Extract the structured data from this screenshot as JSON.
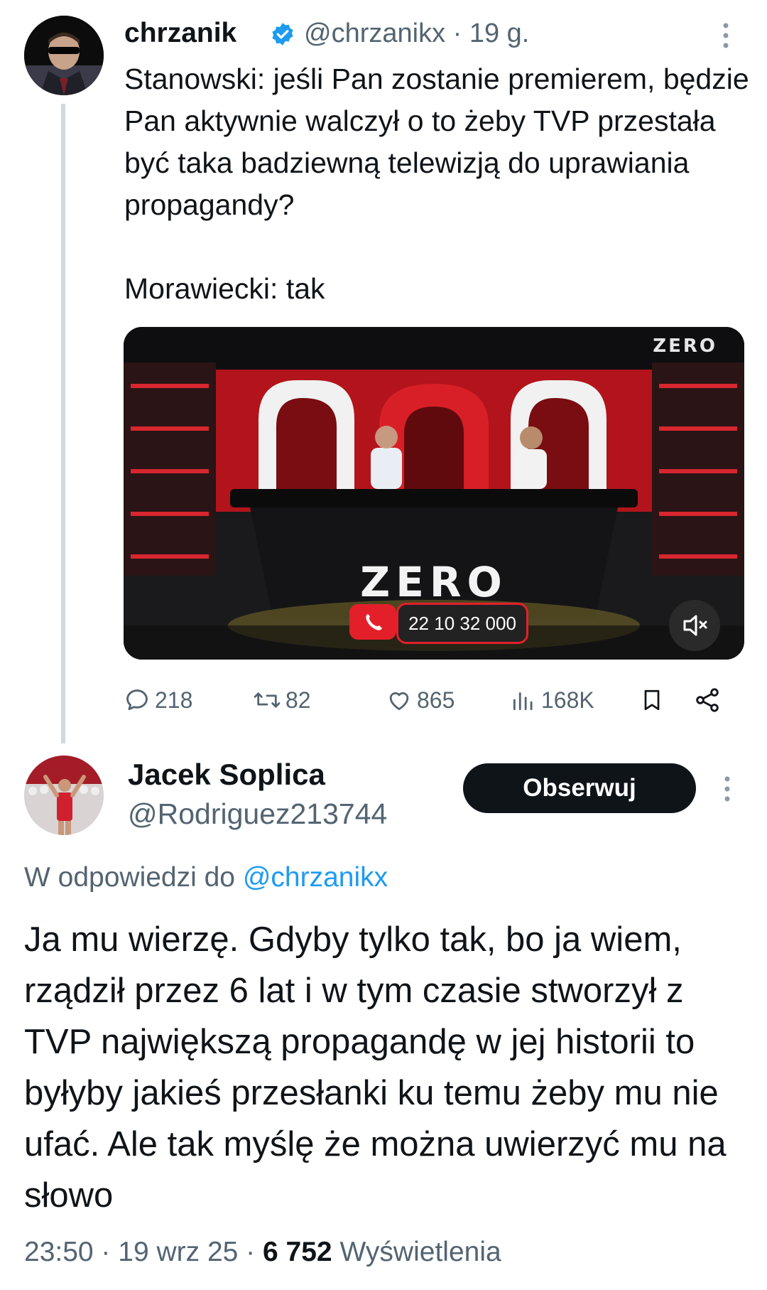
{
  "parent_tweet": {
    "author_name": "chrzanik",
    "handle_time": "@chrzanikx · 19 g.",
    "text": "Stanowski: jeśli Pan zostanie premierem, będzie Pan aktywnie walczył o to żeby TVP przestała być taka badziewną telewizją do uprawiania propagandy?\n\nMorawiecki: tak",
    "media": {
      "corner_logo": "ZERO",
      "desk_logo": "ZERO",
      "phone_number": "22 10 32 000"
    },
    "actions": {
      "replies": "218",
      "retweets": "82",
      "likes": "865",
      "views": "168K"
    }
  },
  "reply_tweet": {
    "author_name": "Jacek Soplica",
    "handle": "@Rodriguez213744",
    "follow_label": "Obserwuj",
    "reply_prefix": "W odpowiedzi do",
    "reply_mention": "@chrzanikx",
    "text": "Ja mu wierzę. Gdyby tylko tak, bo ja wiem, rządził przez 6 lat i w tym czasie stworzył z TVP największą propagandę w jej historii to byłyby jakieś przesłanki ku temu żeby mu nie ufać. Ale tak myślę że można uwierzyć mu na słowo",
    "meta_time": "23:50 · 19 wrz 25 ·",
    "meta_views_count": "6 752",
    "meta_views_label": "Wyświetlenia"
  },
  "colors": {
    "text_primary": "#0f1419",
    "text_secondary": "#536471",
    "accent": "#1d9bf0",
    "thread_line": "#cfd9de",
    "studio_red": "#e3202a"
  },
  "icons": [
    "verified-badge-icon",
    "more-icon",
    "reply-icon",
    "retweet-icon",
    "like-icon",
    "views-icon",
    "bookmark-icon",
    "share-icon",
    "phone-icon",
    "mute-icon"
  ]
}
